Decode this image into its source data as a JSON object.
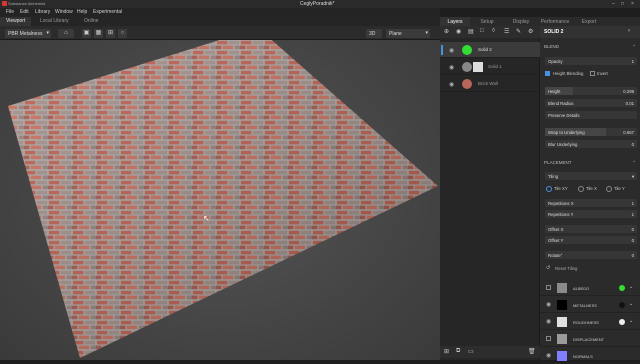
{
  "app": {
    "title": "CeglyPoradnik*",
    "name": "Substance Alchemist"
  },
  "menu": [
    "File",
    "Edit",
    "Library",
    "Window",
    "Help",
    "Experimental"
  ],
  "view_tabs": [
    "Viewport",
    "Local Library",
    "Online"
  ],
  "toolbar": {
    "workflow": "PBR Metalness",
    "view_mode": "3D",
    "shape": "Plane"
  },
  "panel_tabs": [
    "Layers",
    "Setup",
    "Display",
    "Performance",
    "Export"
  ],
  "layers": [
    {
      "name": "Solid 2",
      "swatch": "#33dd33",
      "selected": true
    },
    {
      "name": "Solid 1",
      "swatch": "#888888",
      "selected": false
    },
    {
      "name": "Brick Wall",
      "swatch": "#b8665a",
      "selected": false
    }
  ],
  "props": {
    "header": "SOLID 2",
    "blend_label": "BLEND",
    "opacity_label": "Opacity",
    "opacity_value": "1",
    "height_blending": "Height Blending",
    "invert": "Invert",
    "height_label": "Height",
    "height_value": "0.299",
    "blend_radius_label": "Blend Radius",
    "blend_radius_value": "0.01",
    "preserve_details": "Preserve Details",
    "preserve_value": "0",
    "wrap_label": "Wrap to Underlying",
    "wrap_value": "0.657",
    "blur_label": "Blur Underlying",
    "blur_value": "0",
    "placement_label": "PLACEMENT",
    "tiling_mode": "Tiling",
    "tile_xy": "Tile XY",
    "tile_x": "Tile X",
    "tile_y": "Tile Y",
    "repx_label": "Repetitions X",
    "repx_value": "1",
    "repy_label": "Repetitions Y",
    "repy_value": "1",
    "offx_label": "Offset X",
    "offx_value": "0",
    "offy_label": "Offset Y",
    "offy_value": "0",
    "rotate_label": "Rotate°",
    "rotate_value": "0",
    "reset_label": "Reset Tiling",
    "channels": [
      {
        "name": "ALBEDO",
        "thumb": "#8a8a8a",
        "dot": "#33dd33"
      },
      {
        "name": "METALNESS",
        "thumb": "#000000",
        "dot": "#111111"
      },
      {
        "name": "ROUGHNESS",
        "thumb": "#e0e0e0",
        "dot": "#eeeeee"
      },
      {
        "name": "DISPLACEMENT",
        "thumb": "#9a9a9a",
        "dot": ""
      },
      {
        "name": "NORMALS",
        "thumb": "#8080ff",
        "dot": ""
      }
    ]
  },
  "colors": {
    "accent": "#4a90e2",
    "brick": "#b85a4a",
    "mortar": "#a9a3a0"
  }
}
